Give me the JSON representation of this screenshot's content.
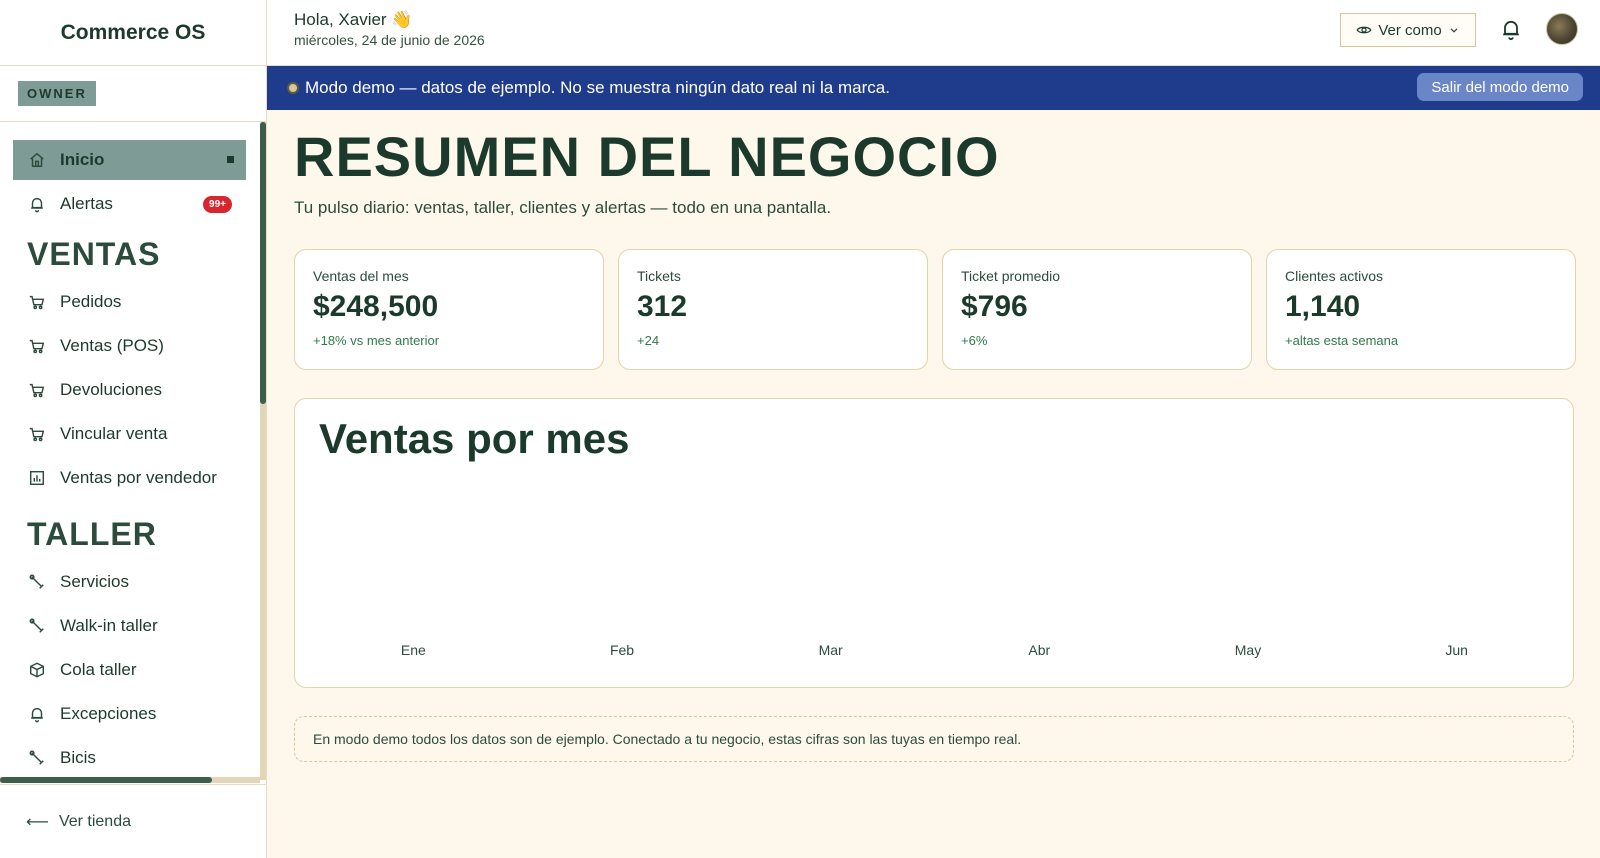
{
  "app": {
    "brand": "Commerce OS",
    "role": "OWNER"
  },
  "sidebar": {
    "top_items": [
      {
        "label": "Inicio",
        "icon": "home-icon",
        "active": true
      },
      {
        "label": "Alertas",
        "icon": "bell-icon",
        "badge": "99+"
      }
    ],
    "sections": [
      {
        "title": "VENTAS",
        "items": [
          {
            "label": "Pedidos",
            "icon": "cart-icon"
          },
          {
            "label": "Ventas (POS)",
            "icon": "cart-icon"
          },
          {
            "label": "Devoluciones",
            "icon": "cart-icon"
          },
          {
            "label": "Vincular venta",
            "icon": "cart-icon"
          },
          {
            "label": "Ventas por vendedor",
            "icon": "bar-chart-icon"
          }
        ]
      },
      {
        "title": "TALLER",
        "items": [
          {
            "label": "Servicios",
            "icon": "wrench-icon"
          },
          {
            "label": "Walk-in taller",
            "icon": "wrench-icon"
          },
          {
            "label": "Cola taller",
            "icon": "box-icon"
          },
          {
            "label": "Excepciones",
            "icon": "bell-icon"
          },
          {
            "label": "Bicis",
            "icon": "wrench-icon"
          }
        ]
      }
    ],
    "footer": {
      "label": "Ver tienda",
      "icon": "arrow-left-icon"
    }
  },
  "header": {
    "greeting": "Hola, Xavier 👋",
    "date": "miércoles, 24 de junio de 2026",
    "view_as": "Ver como"
  },
  "banner": {
    "text": "Modo demo — datos de ejemplo. No se muestra ningún dato real ni la marca.",
    "exit_label": "Salir del modo demo",
    "color": "#1f3b8c"
  },
  "main": {
    "title": "RESUMEN DEL NEGOCIO",
    "subtitle": "Tu pulso diario: ventas, taller, clientes y alertas — todo en una pantalla.",
    "kpis": [
      {
        "label": "Ventas del mes",
        "value": "$248,500",
        "delta": "+18% vs mes anterior"
      },
      {
        "label": "Tickets",
        "value": "312",
        "delta": "+24"
      },
      {
        "label": "Ticket promedio",
        "value": "$796",
        "delta": "+6%"
      },
      {
        "label": "Clientes activos",
        "value": "1,140",
        "delta": "+altas esta semana"
      }
    ],
    "note": "En modo demo todos los datos son de ejemplo. Conectado a tu negocio, estas cifras son las tuyas en tiempo real."
  },
  "chart_data": {
    "type": "bar",
    "title": "Ventas por mes",
    "categories": [
      "Ene",
      "Feb",
      "Mar",
      "Abr",
      "May",
      "Jun"
    ],
    "values": [],
    "xlabel": "",
    "ylabel": ""
  }
}
